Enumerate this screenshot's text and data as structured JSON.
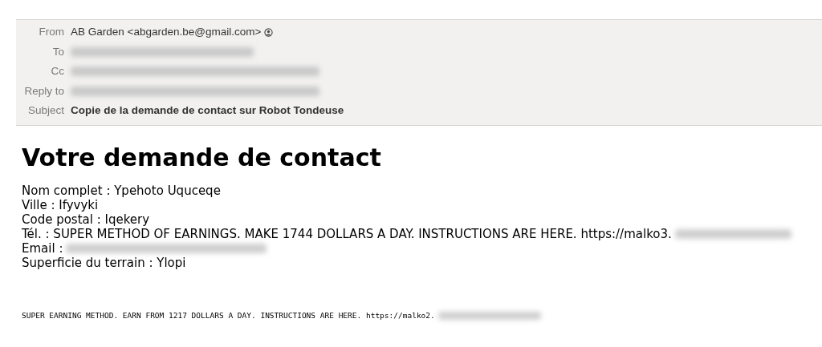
{
  "header": {
    "fields": [
      {
        "label": "From",
        "value": "AB Garden <abgarden.be@gmail.com>",
        "bold": false,
        "redacted": false,
        "contact_icon": true
      },
      {
        "label": "To",
        "redacted": true
      },
      {
        "label": "Cc",
        "redacted": true
      },
      {
        "label": "Reply to",
        "redacted": true
      },
      {
        "label": "Subject",
        "value": "Copie de la demande de contact sur Robot Tondeuse",
        "bold": true,
        "redacted": false,
        "contact_icon": false
      }
    ]
  },
  "body": {
    "heading": "Votre demande de contact",
    "lines": [
      {
        "text": "Nom complet : Ypehoto Uquceqe",
        "redacted_tail": false
      },
      {
        "text": "Ville : Ifyvyki",
        "redacted_tail": false
      },
      {
        "text": "Code postal : Iqekery",
        "redacted_tail": false
      },
      {
        "text": "Tél. : SUPER METHOD OF EARNINGS. MAKE 1744 DOLLARS A DAY. INSTRUCTIONS ARE HERE. https://malko3.",
        "redacted_tail": true
      },
      {
        "text": "Email :",
        "redacted_tail": true
      },
      {
        "text": "Superficie du terrain : Ylopi",
        "redacted_tail": false
      }
    ],
    "footer": {
      "text": "SUPER EARNING METHOD. EARN FROM 1217 DOLLARS A DAY. INSTRUCTIONS ARE HERE. https://malko2.",
      "redacted_tail": true
    }
  }
}
